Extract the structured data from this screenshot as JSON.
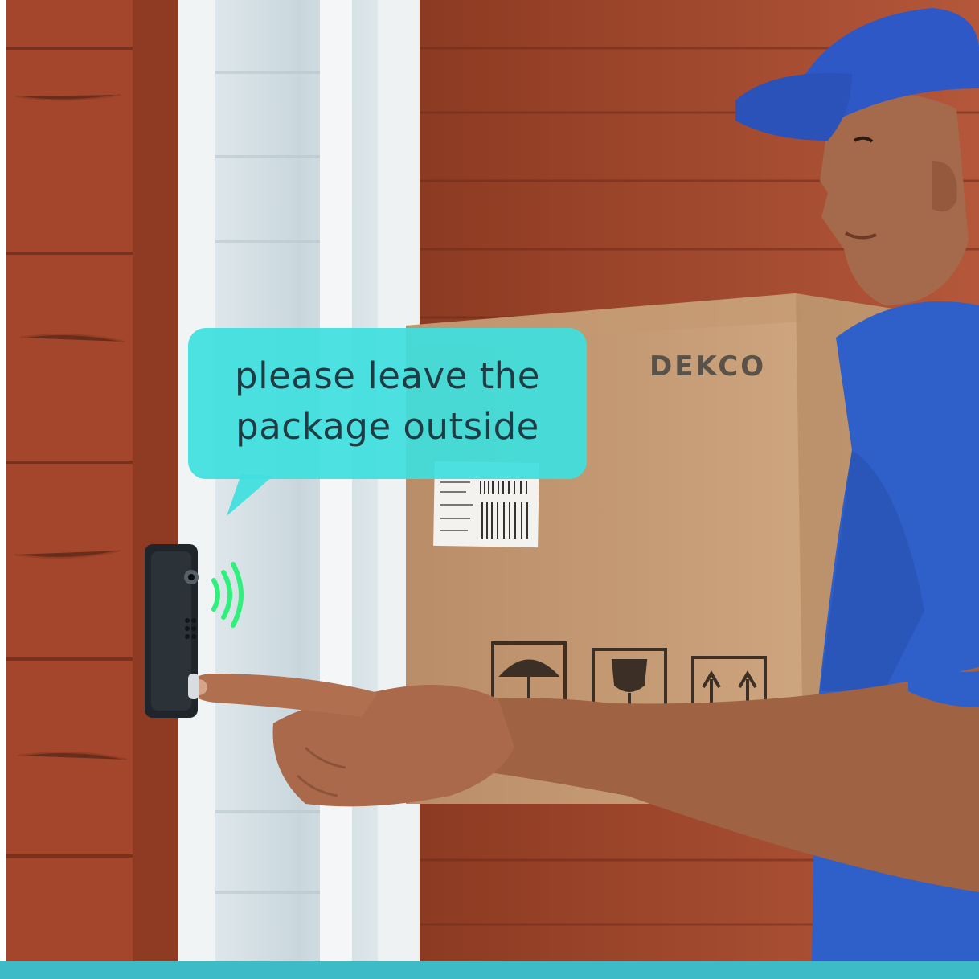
{
  "speech_bubble": {
    "line1": "please leave the",
    "line2": "package outside",
    "fill": "#3ee0de"
  },
  "box": {
    "brand_text": "DEKCO"
  },
  "device": {
    "name": "doorbell-camera",
    "signal_color": "#2ef07a"
  },
  "colors": {
    "accent_bar": "#3dbcc8",
    "wood": "#a0452d",
    "cardboard": "#c8a07b",
    "uniform_blue": "#2f5fc9"
  }
}
